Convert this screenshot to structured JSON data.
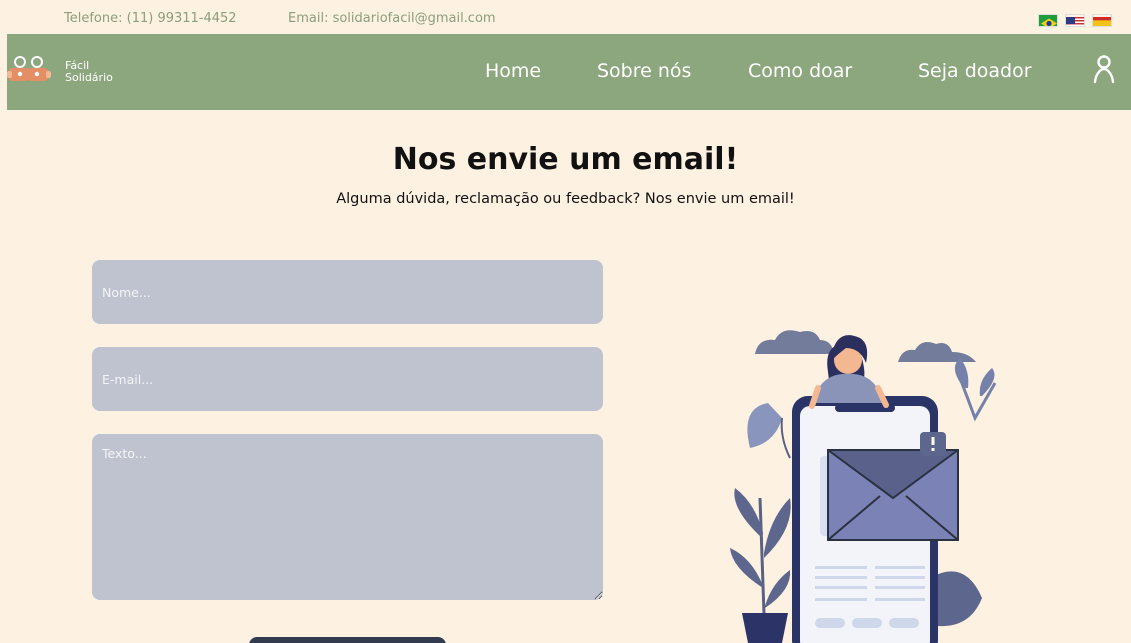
{
  "topbar": {
    "phone": "Telefone: (11) 99311-4452",
    "email": "Email: solidariofacil@gmail.com",
    "languages": [
      {
        "name": "brazil-flag"
      },
      {
        "name": "usa-flag"
      },
      {
        "name": "spain-flag"
      }
    ]
  },
  "nav": {
    "logo": {
      "line1": "Fácil",
      "line2": "Solidário"
    },
    "links": [
      "Home",
      "Sobre nós",
      "Como doar",
      "Seja doador"
    ],
    "user_icon": "user-icon"
  },
  "hero": {
    "title": "Nos envie um email!",
    "subtitle": "Alguma dúvida, reclamação ou feedback? Nos envie um email!"
  },
  "form": {
    "name_placeholder": "Nome...",
    "email_placeholder": "E-mail...",
    "text_placeholder": "Texto..."
  },
  "colors": {
    "background": "#fdf1e2",
    "nav": "#8ca67e",
    "field": "#bfc3cf",
    "accent": "#333b4f"
  }
}
